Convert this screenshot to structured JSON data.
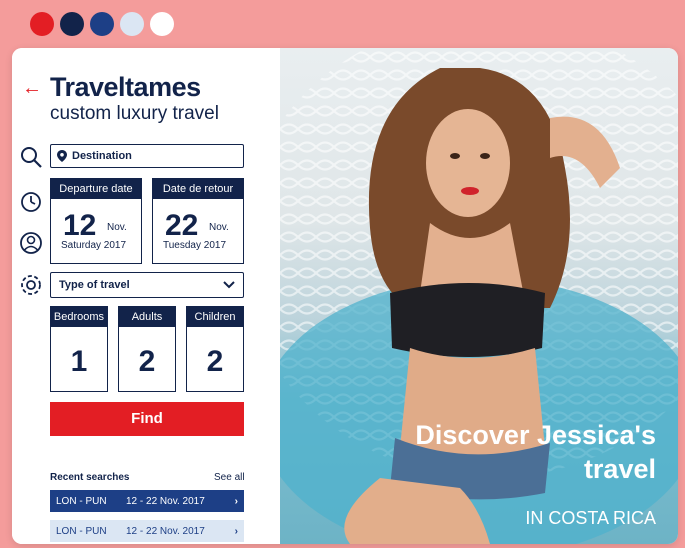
{
  "palette": [
    "#e31e24",
    "#12234a",
    "#1d3f86",
    "#dbe6f3",
    "#ffffff"
  ],
  "brand": {
    "name": "Traveltames",
    "tagline": "custom luxury travel"
  },
  "search": {
    "destination_label": "Destination"
  },
  "dates": {
    "departure": {
      "header": "Departure date",
      "day": "12",
      "month": "Nov.",
      "weekday": "Saturday 2017"
    },
    "return": {
      "header": "Date de retour",
      "day": "22",
      "month": "Nov.",
      "weekday": "Tuesday 2017"
    }
  },
  "travel_type": {
    "label": "Type of travel"
  },
  "counts": [
    {
      "label": "Bedrooms",
      "value": "1"
    },
    {
      "label": "Adults",
      "value": "2"
    },
    {
      "label": "Children",
      "value": "2"
    }
  ],
  "find_button": "Find",
  "recent": {
    "title": "Recent searches",
    "see_all": "See all",
    "rows": [
      {
        "route": "LON - PUN",
        "dates": "12 - 22 Nov. 2017"
      },
      {
        "route": "LON - PUN",
        "dates": "12 - 22 Nov. 2017"
      }
    ]
  },
  "hero": {
    "line1": "Discover Jessica's",
    "line2": "travel",
    "line3": "IN COSTA RICA"
  },
  "icons": [
    "back-arrow-icon",
    "search-icon",
    "timer-icon",
    "user-icon",
    "settings-icon",
    "location-pin-icon",
    "chevron-down-icon",
    "chevron-right-icon"
  ]
}
